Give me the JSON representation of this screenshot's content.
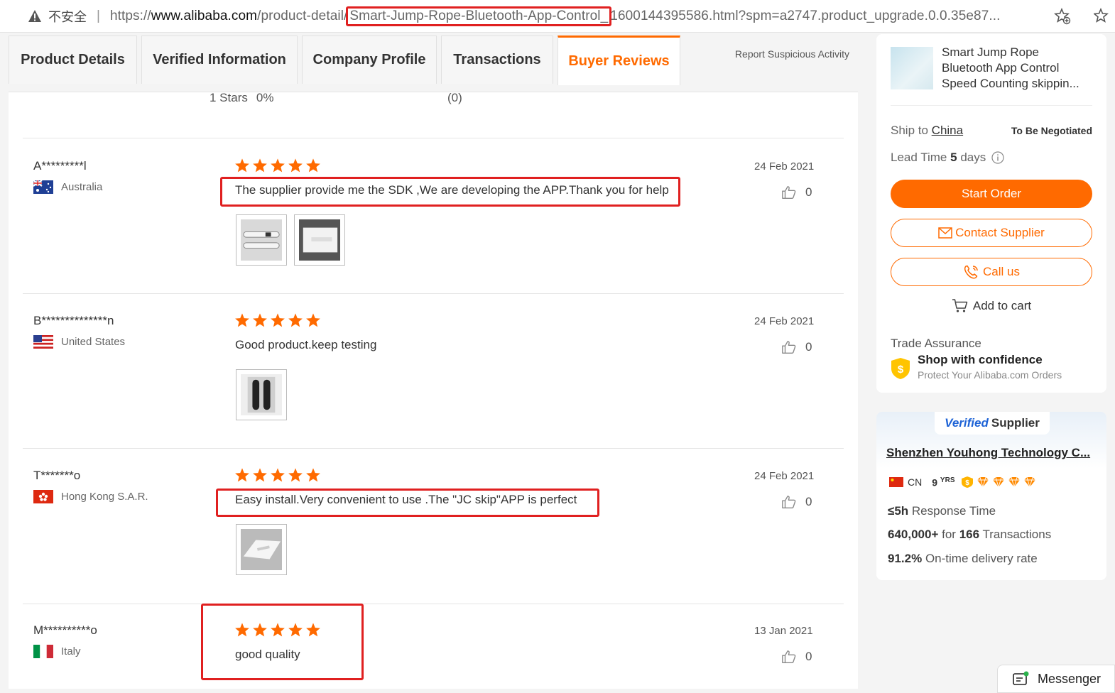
{
  "browser": {
    "security_label": "不安全",
    "url_scheme": "https://",
    "url_host": "www.alibaba.com",
    "url_path_pre": "/product-detail/",
    "url_highlight": "Smart-Jump-Rope-Bluetooth-App-Control_",
    "url_rest": "1600144395586.html?spm=a2747.product_upgrade.0.0.35e87..."
  },
  "tabs": [
    {
      "label": "Product Details"
    },
    {
      "label": "Verified Information"
    },
    {
      "label": "Company Profile"
    },
    {
      "label": "Transactions"
    },
    {
      "label": "Buyer Reviews"
    }
  ],
  "report_link": "Report Suspicious Activity",
  "star_summary": {
    "stars": "1  Stars",
    "percent": "0%",
    "count": "(0)"
  },
  "reviews": [
    {
      "reviewer": "A*********l",
      "country": "Australia",
      "rating": 5,
      "date": "24 Feb 2021",
      "comment": "The supplier provide me the SDK ,We are developing the APP.Thank you for help",
      "likes": "0"
    },
    {
      "reviewer": "B**************n",
      "country": "United States",
      "rating": 5,
      "date": "24 Feb 2021",
      "comment": "Good product.keep testing",
      "likes": "0"
    },
    {
      "reviewer": "T*******o",
      "country": "Hong Kong S.A.R.",
      "rating": 5,
      "date": "24 Feb 2021",
      "comment": "Easy install.Very convenient to use .The \"JC skip\"APP is perfect",
      "likes": "0"
    },
    {
      "reviewer": "M**********o",
      "country": "Italy",
      "rating": 5,
      "date": "13 Jan 2021",
      "comment": "good quality",
      "likes": "0"
    }
  ],
  "product": {
    "title": "Smart Jump Rope Bluetooth App Control Speed Counting skippin...",
    "ship_to_label": "Ship to",
    "ship_to_country": "China",
    "shipping_price": "To Be Negotiated",
    "lead_time_label": "Lead Time",
    "lead_time_value": "5",
    "lead_time_unit": "days",
    "start_order": "Start Order",
    "contact_supplier": "Contact Supplier",
    "call_us": "Call us",
    "add_to_cart": "Add to cart",
    "trade_assurance": "Trade Assurance",
    "trade_headline": "Shop with confidence",
    "trade_sub": "Protect Your Alibaba.com Orders"
  },
  "supplier": {
    "verified_v": "Verified",
    "verified_word": "Supplier",
    "name": "Shenzhen Youhong Technology C...",
    "country_code": "CN",
    "years": "9",
    "years_unit": "YRS",
    "response_value": "≤5h",
    "response_label": "Response Time",
    "revenue_value": "640,000+",
    "revenue_for": "for",
    "transactions_value": "166",
    "transactions_label": "Transactions",
    "ontime_value": "91.2%",
    "ontime_label": "On-time delivery rate"
  },
  "messenger": "Messenger",
  "colors": {
    "accent": "#ff6a00",
    "highlight": "#e02020",
    "verified_blue": "#1e63d6"
  }
}
